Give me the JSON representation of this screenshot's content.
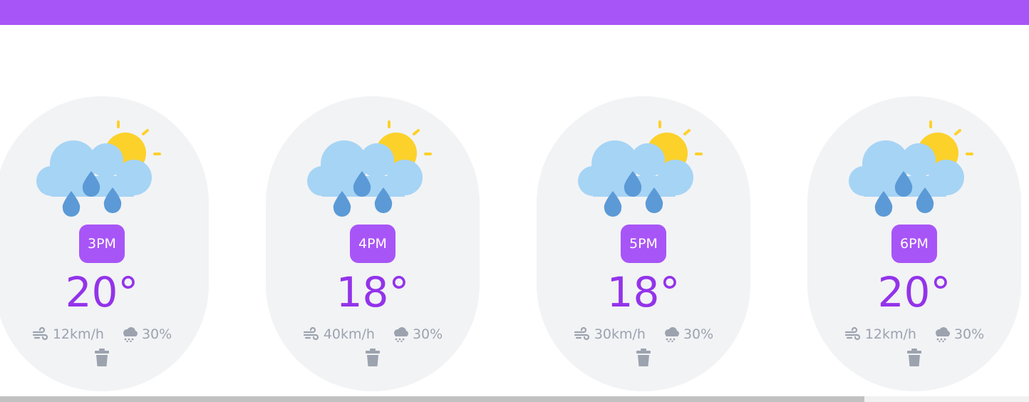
{
  "colors": {
    "accent": "#a855f7",
    "temperature": "#9333ea",
    "card_bg": "#f2f3f5",
    "muted": "#9ca3af",
    "sun": "#fcd12a",
    "cloud": "#a6d4f5",
    "rain": "#5b9ad6"
  },
  "forecast": [
    {
      "time": "3PM",
      "temp": "20°",
      "wind": "12km/h",
      "rain": "30%",
      "icon": "partly-cloudy-rain-icon"
    },
    {
      "time": "4PM",
      "temp": "18°",
      "wind": "40km/h",
      "rain": "30%",
      "icon": "partly-cloudy-rain-icon"
    },
    {
      "time": "5PM",
      "temp": "18°",
      "wind": "30km/h",
      "rain": "30%",
      "icon": "partly-cloudy-rain-icon"
    },
    {
      "time": "6PM",
      "temp": "20°",
      "wind": "12km/h",
      "rain": "30%",
      "icon": "partly-cloudy-rain-icon"
    }
  ],
  "scroll": {
    "thumb_fraction": 0.84
  }
}
